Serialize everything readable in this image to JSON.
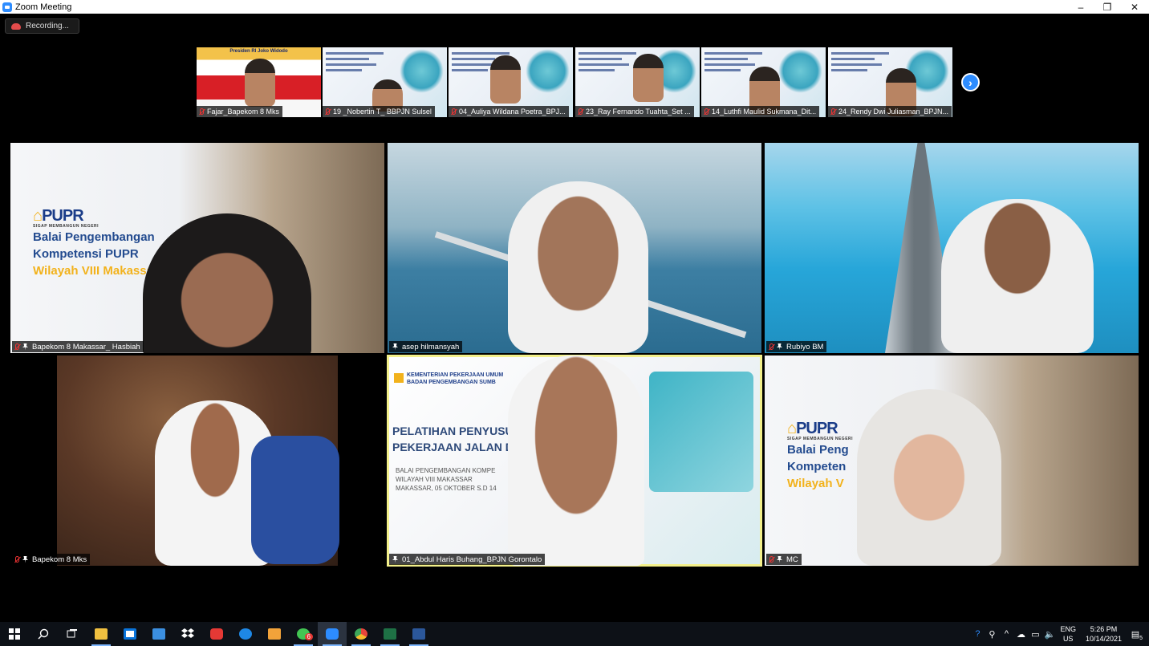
{
  "window": {
    "title": "Zoom Meeting",
    "controls": [
      "–",
      "❐",
      "✕"
    ]
  },
  "recording": {
    "label": "Recording..."
  },
  "thumbnails": [
    {
      "name": "Fajar_Bapekom 8 Mks",
      "banner": "Presiden RI Joko Widodo",
      "muted": true
    },
    {
      "name": "19 _Nobertin T_ BBPJN Sulsel",
      "muted": true
    },
    {
      "name": "04_Auliya Wildana Poetra_BPJ...",
      "muted": true
    },
    {
      "name": "23_Ray Fernando Tuahta_Set ...",
      "muted": true
    },
    {
      "name": "14_Luthfi Maulid Sukmana_Dit...",
      "muted": true
    },
    {
      "name": "24_Rendy Dwi Juliasman_BPJN...",
      "muted": true
    }
  ],
  "tiles": [
    {
      "name": "Bapekom 8 Makassar_ Hasbiah",
      "muted": true,
      "bg": "city",
      "slide": {
        "logo": "PUPR",
        "sub": "SIGAP MEMBANGUN NEGERI",
        "l1": "Balai Pengembangan",
        "l2": "Kompetensi PUPR",
        "l3": "Wilayah VIII Makassar"
      }
    },
    {
      "name": "asep hilmansyah",
      "muted": false,
      "bg": "bridge"
    },
    {
      "name": "Rubiyo BM",
      "muted": true,
      "bg": "sea"
    },
    {
      "name": "Bapekom 8 Mks",
      "muted": true,
      "bg": "wood"
    },
    {
      "name": "01_Abdul Haris Buhang_BPJN Gorontalo",
      "muted": false,
      "bg": "slide",
      "active": true,
      "slide": {
        "h1": "KEMENTERIAN PEKERJAAN UMUM",
        "h2": "BADAN PENGEMBANGAN SUMB",
        "t1": "PELATIHAN PENYUSU",
        "t2": "PEKERJAAN JALAN D",
        "t3": "BALAI PENGEMBANGAN KOMPE",
        "t4": "WILAYAH VIII MAKASSAR",
        "t5": "MAKASSAR, 05 OKTOBER S.D 14"
      }
    },
    {
      "name": "MC",
      "muted": true,
      "bg": "city",
      "slide": {
        "logo": "PUPR",
        "sub": "SIGAP MEMBANGUN NEGERI",
        "l1": "Balai Peng",
        "l2": "Kompeten",
        "l3": "Wilayah V"
      }
    }
  ],
  "taskbar": {
    "apps": [
      {
        "name": "windows-start",
        "color": "#ffffff"
      },
      {
        "name": "search",
        "color": "#ffffff"
      },
      {
        "name": "task-view",
        "color": "#ffffff"
      },
      {
        "name": "file-explorer",
        "color": "#f0c040",
        "running": true
      },
      {
        "name": "store",
        "color": "#ffffff"
      },
      {
        "name": "mail",
        "color": "#3b8fe0"
      },
      {
        "name": "dropbox",
        "color": "#ffffff"
      },
      {
        "name": "app-red",
        "color": "#e53935"
      },
      {
        "name": "edge",
        "color": "#1e88e5"
      },
      {
        "name": "media",
        "color": "#f2a33a"
      },
      {
        "name": "whatsapp",
        "color": "#43c553",
        "badge": "6",
        "running": true
      },
      {
        "name": "zoom",
        "color": "#2d8cff",
        "running": true,
        "active": true
      },
      {
        "name": "chrome",
        "color": "#e8453c",
        "running": true
      },
      {
        "name": "excel",
        "color": "#1e7145",
        "running": true
      },
      {
        "name": "word",
        "color": "#2b579a",
        "running": true
      }
    ],
    "tray": {
      "lang_top": "ENG",
      "lang_bottom": "US",
      "time": "5:26 PM",
      "date": "10/14/2021",
      "notifications": "5"
    }
  }
}
